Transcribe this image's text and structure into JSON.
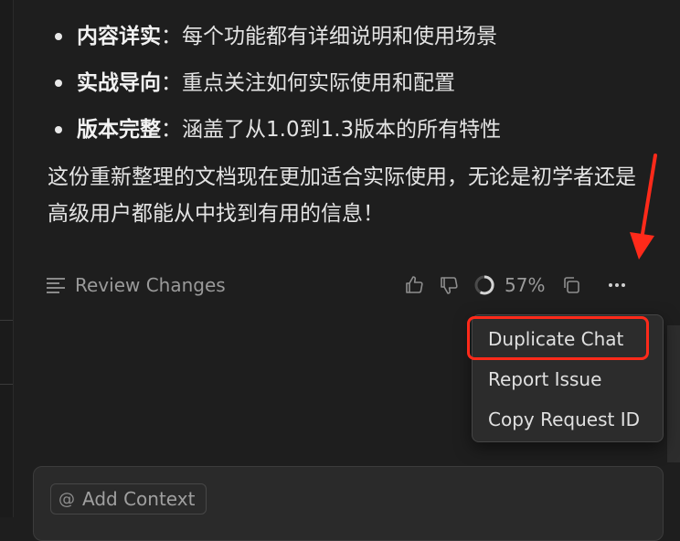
{
  "bullets": [
    {
      "term": "内容详实",
      "sep": "：",
      "desc": "每个功能都有详细说明和使用场景"
    },
    {
      "term": "实战导向",
      "sep": "：",
      "desc": "重点关注如何实际使用和配置"
    },
    {
      "term": "版本完整",
      "sep": "：",
      "desc": "涵盖了从1.0到1.3版本的所有特性"
    }
  ],
  "paragraph": "这份重新整理的文档现在更加适合实际使用，无论是初学者还是高级用户都能从中找到有用的信息！",
  "actions": {
    "review_label": "Review Changes",
    "usage_value": "57%"
  },
  "menu": {
    "items": [
      {
        "label": "Duplicate Chat"
      },
      {
        "label": "Report Issue"
      },
      {
        "label": "Copy Request ID"
      }
    ]
  },
  "composer": {
    "add_context_label": "Add Context",
    "add_context_prefix": "@"
  },
  "colors": {
    "background": "#1e1e1e",
    "annotation": "#ff2a1a",
    "menu_bg": "#2c2c2c"
  },
  "icons": [
    "review-changes-icon",
    "thumbs-up-icon",
    "thumbs-down-icon",
    "progress-ring-icon",
    "copy-icon",
    "more-options-icon"
  ]
}
